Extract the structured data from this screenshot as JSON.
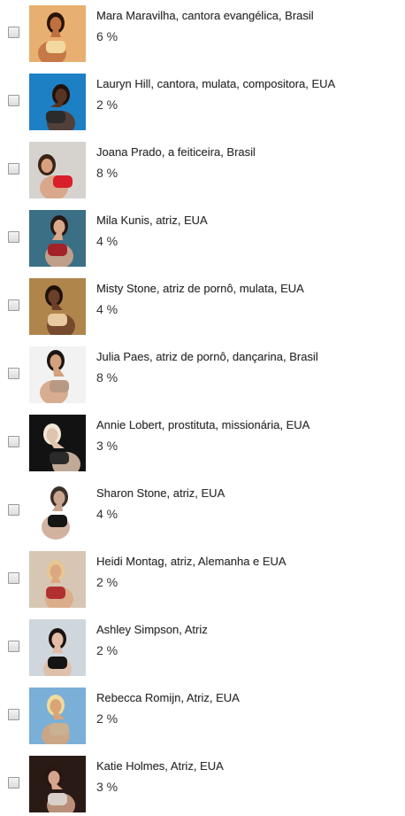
{
  "poll": {
    "options": [
      {
        "label": "Mara Maravilha, cantora evangélica, Brasil",
        "percent": "6 %",
        "thumb": {
          "bg": "#e8b070",
          "skin": "#c07040",
          "hair": "#2a1408",
          "cloth": "#f2d9a0"
        }
      },
      {
        "label": "Lauryn Hill, cantora, mulata, compositora, EUA",
        "percent": "2 %",
        "thumb": {
          "bg": "#1d7fc4",
          "skin": "#5a3422",
          "hair": "#20120a",
          "cloth": "#2b2b2b"
        }
      },
      {
        "label": "Joana Prado, a feiticeira, Brasil",
        "percent": "8 %",
        "thumb": {
          "bg": "#d6d3cf",
          "skin": "#d9a080",
          "hair": "#3a2416",
          "cloth": "#d81f2a"
        }
      },
      {
        "label": "Mila Kunis, atriz, EUA",
        "percent": "4 %",
        "thumb": {
          "bg": "#3b6f86",
          "skin": "#d8a88a",
          "hair": "#241612",
          "cloth": "#a3222a"
        }
      },
      {
        "label": "Misty Stone, atriz de pornô, mulata, EUA",
        "percent": "4 %",
        "thumb": {
          "bg": "#b0854c",
          "skin": "#6c4028",
          "hair": "#1e1208",
          "cloth": "#e8c9a0"
        }
      },
      {
        "label": "Julia Paes, atriz de pornô, dançarina, Brasil",
        "percent": "8 %",
        "thumb": {
          "bg": "#f2f2f2",
          "skin": "#d4a07e",
          "hair": "#1c1410",
          "cloth": "#b89a84"
        }
      },
      {
        "label": "Annie Lobert, prostituta, missionária, EUA",
        "percent": "3 %",
        "thumb": {
          "bg": "#121212",
          "skin": "#e0c4b0",
          "hair": "#f0e8d8",
          "cloth": "#2a2a2a"
        }
      },
      {
        "label": "Sharon Stone, atriz, EUA",
        "percent": "4 %",
        "thumb": {
          "bg": "#ffffff",
          "skin": "#caa690",
          "hair": "#3a3028",
          "cloth": "#151515"
        }
      },
      {
        "label": "Heidi Montag, atriz, Alemanha e EUA",
        "percent": "2 %",
        "thumb": {
          "bg": "#d8c6b4",
          "skin": "#dca884",
          "hair": "#e6c890",
          "cloth": "#b03030"
        }
      },
      {
        "label": "Ashley Simpson, Atriz",
        "percent": "2 %",
        "thumb": {
          "bg": "#cfd6dc",
          "skin": "#e2bca4",
          "hair": "#1a1210",
          "cloth": "#141414"
        }
      },
      {
        "label": "Rebecca Romijn, Atriz, EUA",
        "percent": "2 %",
        "thumb": {
          "bg": "#7ab0d8",
          "skin": "#d8a478",
          "hair": "#f0dc9c",
          "cloth": "#c8b090"
        }
      },
      {
        "label": "Katie Holmes, Atriz, EUA",
        "percent": "3 %",
        "thumb": {
          "bg": "#2a1a16",
          "skin": "#d4a48c",
          "hair": "#2a1610",
          "cloth": "#d8d0c8"
        }
      }
    ]
  }
}
